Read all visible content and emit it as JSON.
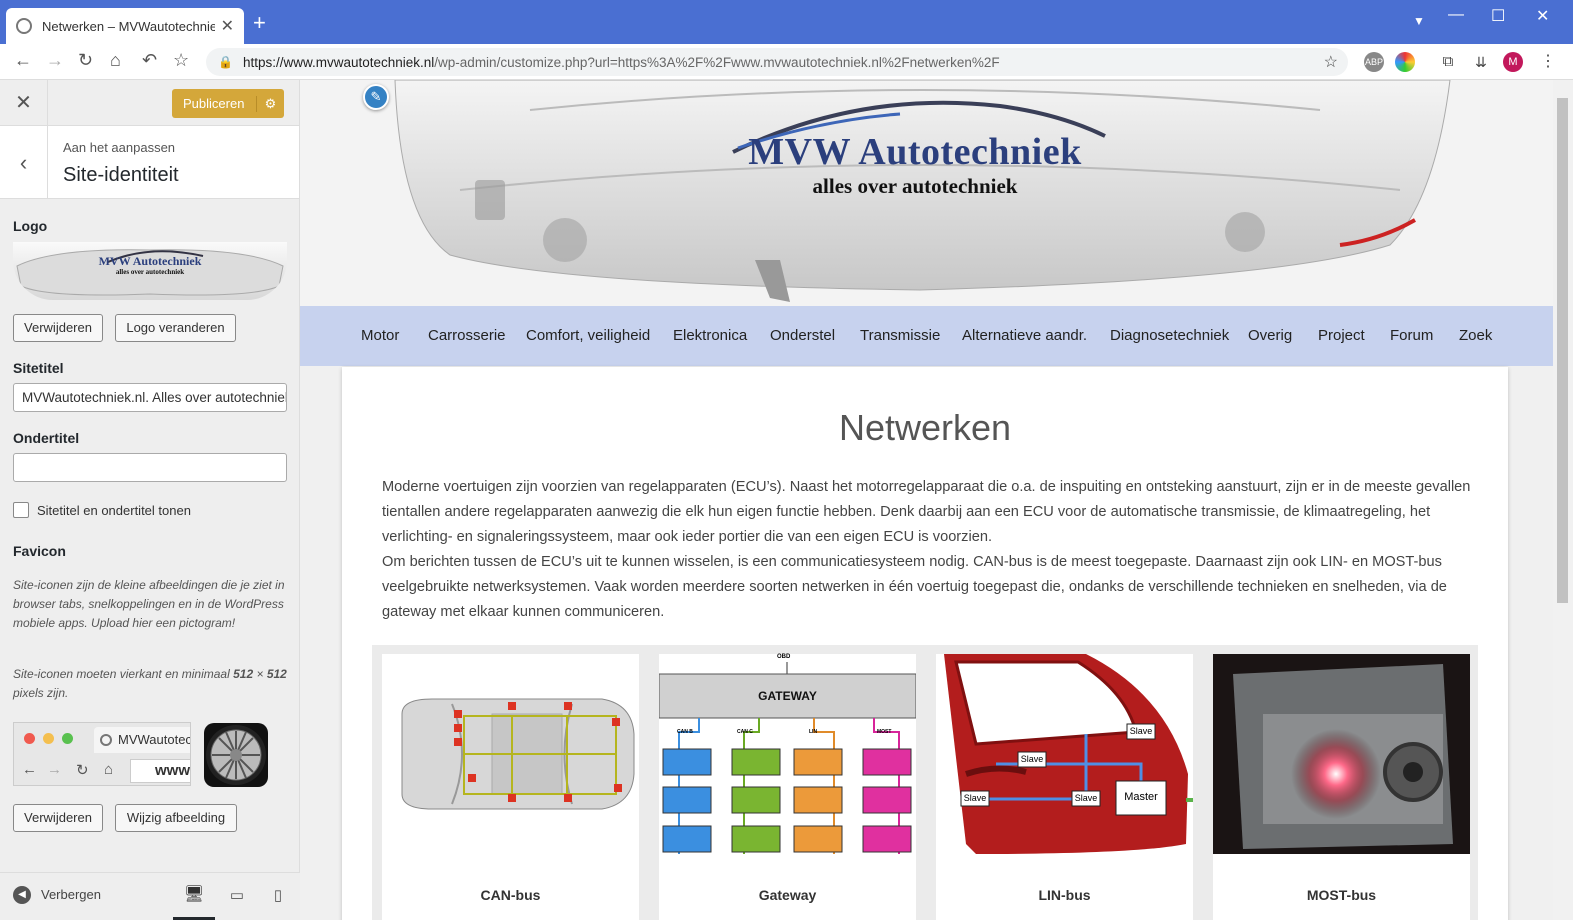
{
  "browser": {
    "tab_title": "Netwerken – MVWautotechniek.nl",
    "url_host": "https://www.mvwautotechniek.nl",
    "url_path": "/wp-admin/customize.php?url=https%3A%2F%2Fwww.mvwautotechniek.nl%2Fnetwerken%2F",
    "profile_initial": "M"
  },
  "customizer": {
    "publish_label": "Publiceren",
    "breadcrumb_sub": "Aan het aanpassen",
    "section_title": "Site-identiteit",
    "logo_label": "Logo",
    "logo_title": "MVW Autotechniek",
    "logo_tagline": "alles over autotechniek",
    "remove_label": "Verwijderen",
    "change_logo_label": "Logo veranderen",
    "site_title_label": "Sitetitel",
    "site_title_value": "MVWautotechniek.nl. Alles over autotechniek",
    "tagline_label": "Ondertitel",
    "tagline_value": "",
    "show_title_label": "Sitetitel en ondertitel tonen",
    "favicon_label": "Favicon",
    "favicon_help_1": "Site-iconen zijn de kleine afbeeldingen die je ziet in browser tabs, snelkoppelingen en in de WordPress mobiele apps. Upload hier een pictogram!",
    "favicon_help_2a": "Site-iconen moeten vierkant en minimaal ",
    "favicon_help_2b": "512",
    "favicon_help_2c": " × ",
    "favicon_help_2d": "512",
    "favicon_help_2e": " pixels zijn.",
    "favicon_tab_label": "MVWautotec",
    "favicon_url_text": "www.",
    "favicon_remove_label": "Verwijderen",
    "favicon_change_label": "Wijzig afbeelding",
    "hide_label": "Verbergen"
  },
  "site": {
    "brand": "MVW Autotechniek",
    "tagline": "alles over autotechniek",
    "menu": [
      "Motor",
      "Carrosserie",
      "Comfort, veiligheid",
      "Elektronica",
      "Onderstel",
      "Transmissie",
      "Alternatieve aandr.",
      "Diagnosetechniek",
      "Overig",
      "Project",
      "Forum",
      "Zoek"
    ],
    "page_title": "Netwerken",
    "paragraph_1": "Moderne voertuigen zijn voorzien van regelapparaten (ECU’s). Naast het motorregelapparaat die o.a. de inspuiting en ontsteking aanstuurt, zijn er in de meeste gevallen tientallen andere regelapparaten aanwezig die elk hun eigen functie hebben. Denk daarbij aan een ECU voor de automatische transmissie, de klimaatregeling, het verlichting- en signaleringssysteem, maar ook ieder portier die van een eigen ECU is voorzien.",
    "paragraph_2": "Om berichten tussen de ECU’s uit te kunnen wisselen, is een communicatiesysteem nodig. CAN-bus is de meest toegepaste. Daarnaast zijn ook LIN- en MOST-bus veelgebruikte netwerksystemen. Vaak worden meerdere soorten netwerken in één voertuig toegepast die, ondanks de verschillende technieken en snelheden, via de gateway met elkaar kunnen communiceren.",
    "tiles": [
      {
        "caption": "CAN-bus"
      },
      {
        "caption": "Gateway"
      },
      {
        "caption": "LIN-bus"
      },
      {
        "caption": "MOST-bus"
      }
    ],
    "gateway": {
      "top": "OBD",
      "title": "GATEWAY",
      "buses": [
        "CAN B",
        "CAN C",
        "LIN",
        "MOST"
      ]
    },
    "lin": {
      "slave": "Slave",
      "master": "Master"
    }
  }
}
